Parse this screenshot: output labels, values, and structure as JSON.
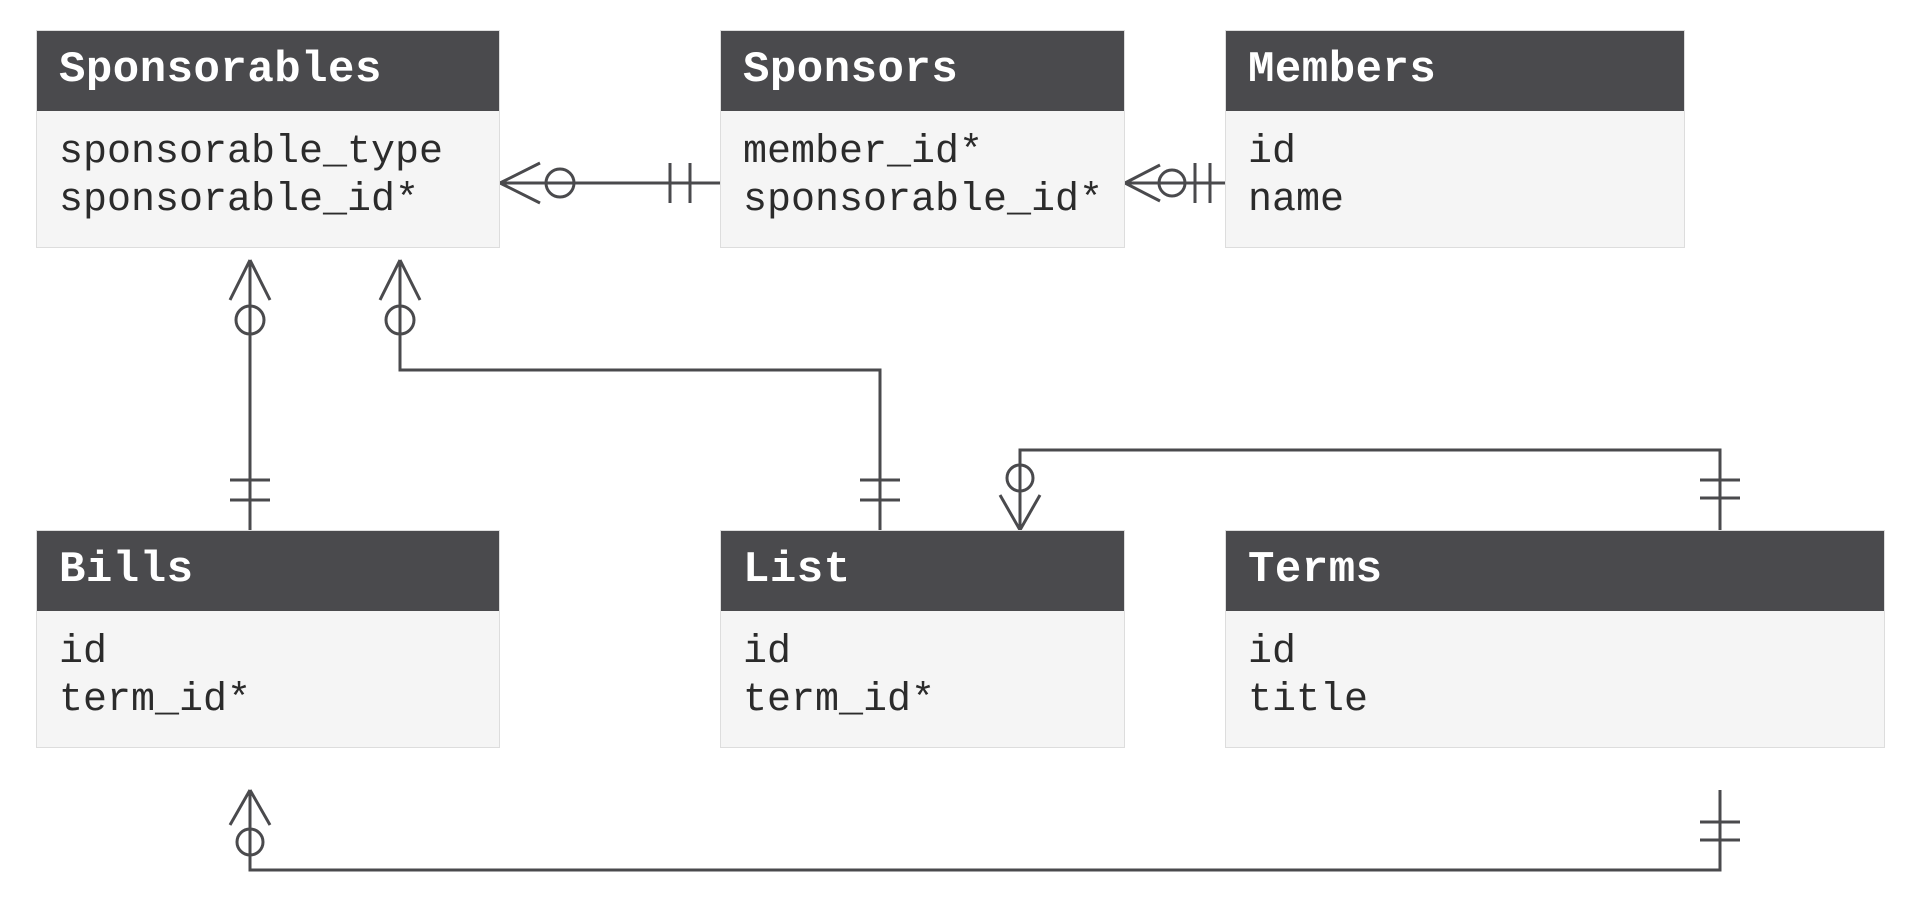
{
  "entities": {
    "sponsorables": {
      "title": "Sponsorables",
      "fields": [
        "sponsorable_type",
        "sponsorable_id*"
      ]
    },
    "sponsors": {
      "title": "Sponsors",
      "fields": [
        "member_id*",
        "sponsorable_id*"
      ]
    },
    "members": {
      "title": "Members",
      "fields": [
        "id",
        "name"
      ]
    },
    "bills": {
      "title": "Bills",
      "fields": [
        "id",
        "term_id*"
      ]
    },
    "list": {
      "title": "List",
      "fields": [
        "id",
        "term_id*"
      ]
    },
    "terms": {
      "title": "Terms",
      "fields": [
        "id",
        "title"
      ]
    }
  },
  "relations": [
    {
      "from": "sponsorables",
      "to": "sponsors",
      "from_card": "many_optional",
      "to_card": "one_mandatory"
    },
    {
      "from": "sponsors",
      "to": "members",
      "from_card": "many_optional",
      "to_card": "one_mandatory"
    },
    {
      "from": "sponsorables",
      "to": "bills",
      "from_card": "many_optional",
      "to_card": "one_mandatory"
    },
    {
      "from": "sponsorables",
      "to": "list",
      "from_card": "many_optional",
      "to_card": "one_mandatory"
    },
    {
      "from": "list",
      "to": "terms",
      "from_card": "many_optional",
      "to_card": "one_mandatory"
    },
    {
      "from": "bills",
      "to": "terms",
      "from_card": "many_optional",
      "to_card": "one_mandatory"
    }
  ],
  "cardinality_legend": {
    "many_optional": "crow's foot with hollow circle (zero or many)",
    "one_mandatory": "double tick (exactly one)"
  }
}
